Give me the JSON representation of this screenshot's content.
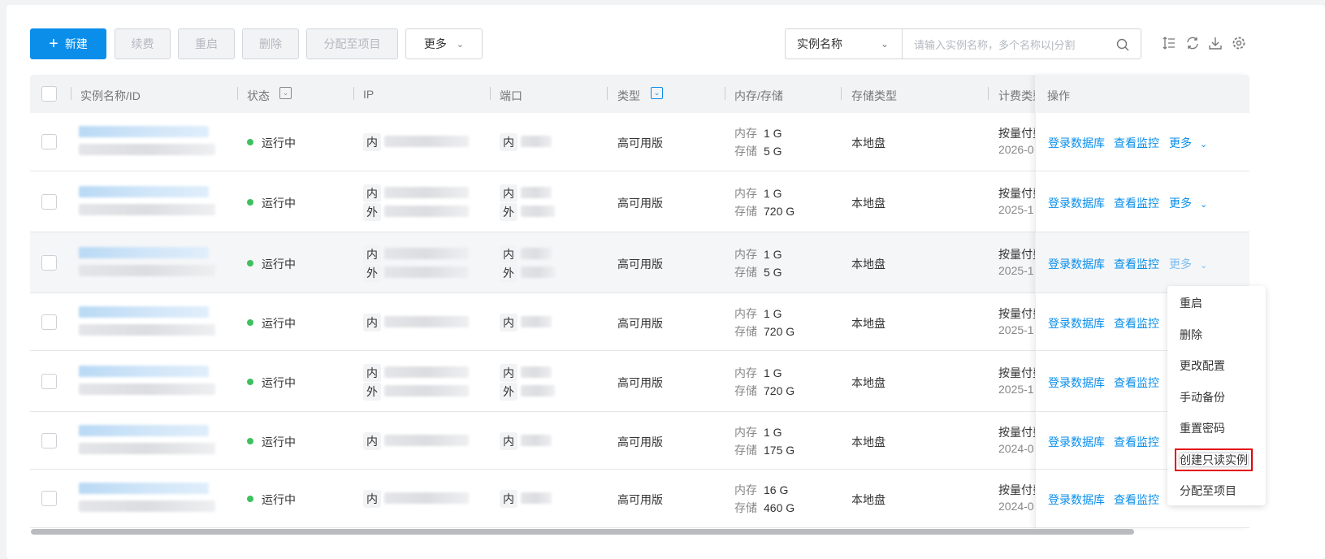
{
  "toolbar": {
    "new_label": "新建",
    "renew_label": "续费",
    "restart_label": "重启",
    "delete_label": "删除",
    "assign_label": "分配至项目",
    "more_label": "更多"
  },
  "search": {
    "field": "实例名称",
    "placeholder": "请输入实例名称，多个名称以|分割"
  },
  "columns": {
    "name": "实例名称/ID",
    "status": "状态",
    "ip": "IP",
    "port": "端口",
    "type": "类型",
    "mem": "内存/存储",
    "storage_type": "存储类型",
    "billing": "计费类型",
    "actions": "操作"
  },
  "labels": {
    "inner": "内",
    "outer": "外",
    "mem": "内存",
    "disk": "存储",
    "login": "登录数据库",
    "monitor": "查看监控",
    "more": "更多"
  },
  "rows": [
    {
      "status": "运行中",
      "has_outer": false,
      "type": "高可用版",
      "mem": "1 G",
      "disk": "5 G",
      "storage_type": "本地盘",
      "billing": "按量付费",
      "date": "2026-0"
    },
    {
      "status": "运行中",
      "has_outer": true,
      "type": "高可用版",
      "mem": "1 G",
      "disk": "720 G",
      "storage_type": "本地盘",
      "billing": "按量付费",
      "date": "2025-1"
    },
    {
      "status": "运行中",
      "has_outer": true,
      "type": "高可用版",
      "mem": "1 G",
      "disk": "5 G",
      "storage_type": "本地盘",
      "billing": "按量付费",
      "date": "2025-1"
    },
    {
      "status": "运行中",
      "has_outer": false,
      "type": "高可用版",
      "mem": "1 G",
      "disk": "720 G",
      "storage_type": "本地盘",
      "billing": "按量付费",
      "date": "2025-1"
    },
    {
      "status": "运行中",
      "has_outer": true,
      "type": "高可用版",
      "mem": "1 G",
      "disk": "720 G",
      "storage_type": "本地盘",
      "billing": "按量付费",
      "date": "2025-1"
    },
    {
      "status": "运行中",
      "has_outer": false,
      "type": "高可用版",
      "mem": "1 G",
      "disk": "175 G",
      "storage_type": "本地盘",
      "billing": "按量付费",
      "date": "2024-0"
    },
    {
      "status": "运行中",
      "has_outer": false,
      "type": "高可用版",
      "mem": "16 G",
      "disk": "460 G",
      "storage_type": "本地盘",
      "billing": "按量付费",
      "date": "2024-0"
    }
  ],
  "dropdown": [
    "重启",
    "删除",
    "更改配置",
    "手动备份",
    "重置密码",
    "创建只读实例",
    "分配至项目"
  ],
  "colors": {
    "primary": "#0a8eea",
    "running": "#3ec05f",
    "highlight": "#e3000b"
  }
}
